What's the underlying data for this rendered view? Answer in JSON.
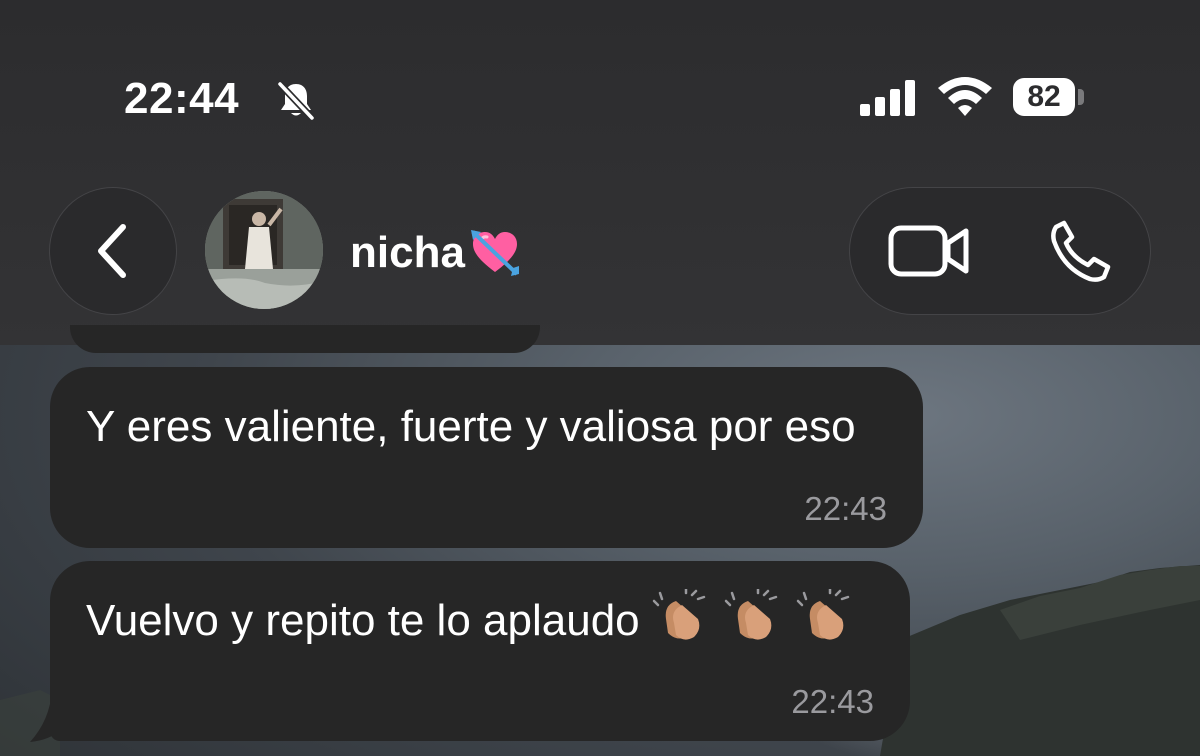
{
  "status_bar": {
    "time": "22:44",
    "battery": "82",
    "icons": [
      "bell-slash-icon",
      "cellular-signal-icon",
      "wifi-icon",
      "battery-icon"
    ]
  },
  "header": {
    "contact_name": "nicha",
    "name_emoji": "heart-with-arrow-icon",
    "buttons": [
      "back-button",
      "video-call-button",
      "voice-call-button"
    ]
  },
  "messages": [
    {
      "text": "Y eres valiente, fuerte y valiosa por eso",
      "time": "22:43"
    },
    {
      "text": "Vuelvo y repito te lo aplaudo",
      "emojis": "👏🏽👏🏽👏🏽",
      "time": "22:43"
    }
  ],
  "colors": {
    "header_bg": "#2c2c2e",
    "bubble_bg": "#262626",
    "text": "#ffffff",
    "timestamp": "#9a9a9e"
  }
}
